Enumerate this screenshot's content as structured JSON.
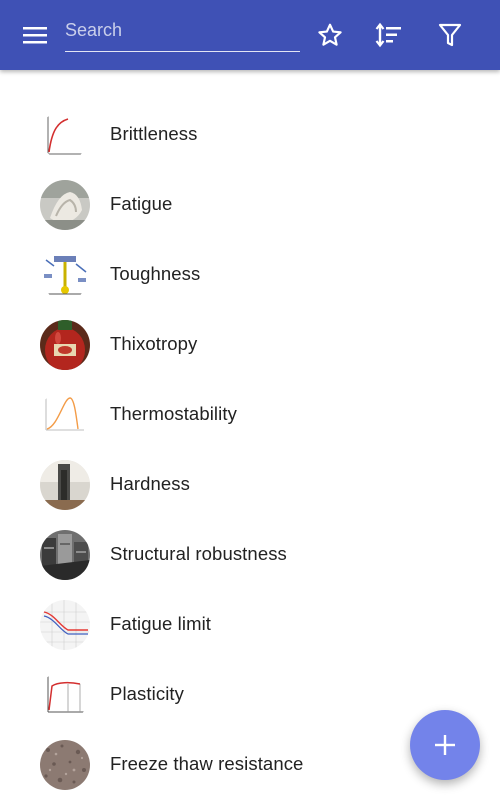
{
  "toolbar": {
    "menu_icon": "menu-icon",
    "search": {
      "placeholder": "Search",
      "value": ""
    },
    "favorite_icon": "star-outline-icon",
    "sort_icon": "sort-icon",
    "filter_icon": "filter-icon",
    "background_color": "#3f51b5"
  },
  "list": {
    "items": [
      {
        "label": "Brittleness",
        "icon": "stress-strain-curve-thumbnail"
      },
      {
        "label": "Fatigue",
        "icon": "fatigue-photo-thumbnail"
      },
      {
        "label": "Toughness",
        "icon": "impact-test-diagram-thumbnail"
      },
      {
        "label": "Thixotropy",
        "icon": "ketchup-bottle-thumbnail"
      },
      {
        "label": "Thermostability",
        "icon": "thermostability-curve-thumbnail"
      },
      {
        "label": "Hardness",
        "icon": "hardness-tester-thumbnail"
      },
      {
        "label": "Structural robustness",
        "icon": "collapsed-building-thumbnail"
      },
      {
        "label": "Fatigue limit",
        "icon": "sn-curve-thumbnail"
      },
      {
        "label": "Plasticity",
        "icon": "plasticity-graph-thumbnail"
      },
      {
        "label": "Freeze thaw resistance",
        "icon": "concrete-texture-thumbnail"
      }
    ]
  },
  "fab": {
    "icon": "plus-icon",
    "color": "#7383ea"
  }
}
